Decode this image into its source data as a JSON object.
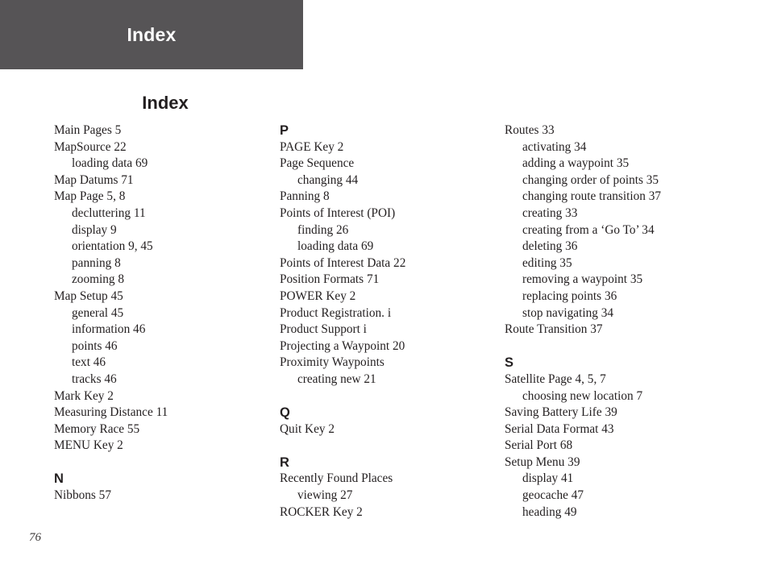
{
  "banner": {
    "chapter_title": "Index",
    "background_color": "#565456",
    "text_color": "#ffffff"
  },
  "page": {
    "title": "Index",
    "folio": "76"
  },
  "columns": [
    {
      "id": "column-1",
      "blocks": [
        {
          "type": "entry",
          "level": 1,
          "text": "Main Pages  5"
        },
        {
          "type": "entry",
          "level": 1,
          "text": "MapSource  22"
        },
        {
          "type": "entry",
          "level": 2,
          "text": "loading data  69"
        },
        {
          "type": "entry",
          "level": 1,
          "text": "Map Datums  71"
        },
        {
          "type": "entry",
          "level": 1,
          "text": "Map Page  5, 8"
        },
        {
          "type": "entry",
          "level": 2,
          "text": "decluttering  11"
        },
        {
          "type": "entry",
          "level": 2,
          "text": "display  9"
        },
        {
          "type": "entry",
          "level": 2,
          "text": "orientation  9, 45"
        },
        {
          "type": "entry",
          "level": 2,
          "text": "panning  8"
        },
        {
          "type": "entry",
          "level": 2,
          "text": "zooming  8"
        },
        {
          "type": "entry",
          "level": 1,
          "text": "Map Setup  45"
        },
        {
          "type": "entry",
          "level": 2,
          "text": "general  45"
        },
        {
          "type": "entry",
          "level": 2,
          "text": "information  46"
        },
        {
          "type": "entry",
          "level": 2,
          "text": "points  46"
        },
        {
          "type": "entry",
          "level": 2,
          "text": "text  46"
        },
        {
          "type": "entry",
          "level": 2,
          "text": "tracks  46"
        },
        {
          "type": "entry",
          "level": 1,
          "text": "Mark Key  2"
        },
        {
          "type": "entry",
          "level": 1,
          "text": "Measuring Distance  11"
        },
        {
          "type": "entry",
          "level": 1,
          "text": "Memory Race  55"
        },
        {
          "type": "entry",
          "level": 1,
          "text": "MENU Key  2"
        },
        {
          "type": "gap"
        },
        {
          "type": "letter",
          "text": "N"
        },
        {
          "type": "entry",
          "level": 1,
          "text": "Nibbons  57"
        }
      ]
    },
    {
      "id": "column-2",
      "blocks": [
        {
          "type": "letter",
          "text": "P"
        },
        {
          "type": "entry",
          "level": 1,
          "text": "PAGE Key  2"
        },
        {
          "type": "entry",
          "level": 1,
          "text": "Page Sequence"
        },
        {
          "type": "entry",
          "level": 2,
          "text": "changing  44"
        },
        {
          "type": "entry",
          "level": 1,
          "text": "Panning  8"
        },
        {
          "type": "entry",
          "level": 1,
          "text": "Points of Interest (POI)"
        },
        {
          "type": "entry",
          "level": 2,
          "text": "finding  26"
        },
        {
          "type": "entry",
          "level": 2,
          "text": "loading data  69"
        },
        {
          "type": "entry",
          "level": 1,
          "text": "Points of Interest Data  22"
        },
        {
          "type": "entry",
          "level": 1,
          "text": "Position Formats  71"
        },
        {
          "type": "entry",
          "level": 1,
          "text": "POWER Key  2"
        },
        {
          "type": "entry",
          "level": 1,
          "text": "Product Registration.  i"
        },
        {
          "type": "entry",
          "level": 1,
          "text": "Product Support  i"
        },
        {
          "type": "entry",
          "level": 1,
          "text": "Projecting a Waypoint  20"
        },
        {
          "type": "entry",
          "level": 1,
          "text": "Proximity Waypoints"
        },
        {
          "type": "entry",
          "level": 2,
          "text": "creating new  21"
        },
        {
          "type": "gap"
        },
        {
          "type": "letter",
          "text": "Q"
        },
        {
          "type": "entry",
          "level": 1,
          "text": "Quit Key  2"
        },
        {
          "type": "gap"
        },
        {
          "type": "letter",
          "text": "R"
        },
        {
          "type": "entry",
          "level": 1,
          "text": "Recently Found Places"
        },
        {
          "type": "entry",
          "level": 2,
          "text": "viewing  27"
        },
        {
          "type": "entry",
          "level": 1,
          "text": "ROCKER Key  2"
        }
      ]
    },
    {
      "id": "column-3",
      "blocks": [
        {
          "type": "entry",
          "level": 1,
          "text": "Routes  33"
        },
        {
          "type": "entry",
          "level": 2,
          "text": "activating  34"
        },
        {
          "type": "entry",
          "level": 2,
          "text": "adding a waypoint  35"
        },
        {
          "type": "entry",
          "level": 2,
          "text": "changing order of points  35"
        },
        {
          "type": "entry",
          "level": 2,
          "text": "changing route transition  37"
        },
        {
          "type": "entry",
          "level": 2,
          "text": "creating  33"
        },
        {
          "type": "entry",
          "level": 2,
          "text": "creating from a ‘Go To’  34"
        },
        {
          "type": "entry",
          "level": 2,
          "text": "deleting  36"
        },
        {
          "type": "entry",
          "level": 2,
          "text": "editing  35"
        },
        {
          "type": "entry",
          "level": 2,
          "text": "removing a waypoint  35"
        },
        {
          "type": "entry",
          "level": 2,
          "text": "replacing points  36"
        },
        {
          "type": "entry",
          "level": 2,
          "text": "stop navigating  34"
        },
        {
          "type": "entry",
          "level": 1,
          "text": "Route Transition  37"
        },
        {
          "type": "gap"
        },
        {
          "type": "letter",
          "text": "S"
        },
        {
          "type": "entry",
          "level": 1,
          "text": "Satellite Page  4, 5, 7"
        },
        {
          "type": "entry",
          "level": 2,
          "text": "choosing new location  7"
        },
        {
          "type": "entry",
          "level": 1,
          "text": "Saving Battery Life  39"
        },
        {
          "type": "entry",
          "level": 1,
          "text": "Serial Data Format  43"
        },
        {
          "type": "entry",
          "level": 1,
          "text": "Serial Port  68"
        },
        {
          "type": "entry",
          "level": 1,
          "text": "Setup Menu  39"
        },
        {
          "type": "entry",
          "level": 2,
          "text": "display  41"
        },
        {
          "type": "entry",
          "level": 2,
          "text": "geocache  47"
        },
        {
          "type": "entry",
          "level": 2,
          "text": "heading  49"
        }
      ]
    }
  ]
}
